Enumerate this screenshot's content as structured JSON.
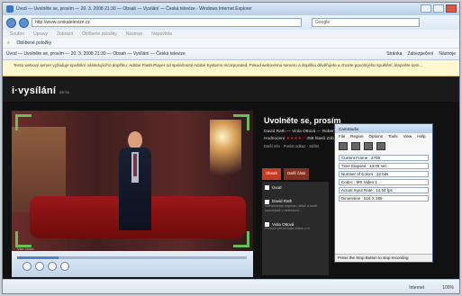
{
  "browser": {
    "title": "Úvod — Uvolněte se, prosím — 20. 3. 2008 21:30 — Obsah — Vysílání — Česká televize - Windows Internet Explorer",
    "url": "http://www.ceskatelevize.cz",
    "search_placeholder": "Google",
    "menu": [
      "Soubor",
      "Úpravy",
      "Zobrazit",
      "Oblíbené položky",
      "Nástroje",
      "Nápověda"
    ],
    "favorites_label": "Oblíbené položky",
    "tab_title": "Úvod — Uvolněte se, prosím — 20. 3. 2008 21:30 — Obsah — Vysílání — Česká televize",
    "commands": [
      "Stránka",
      "Zabezpečení",
      "Nástroje"
    ],
    "info_message": "Tento webový server vyžaduje spuštění následujícího doplňku: Adobe Flash Player od společnosti Adobe Systems Incorporated. Pokud webovému serveru a doplňku důvěřujete a chcete povolit jeho spuštění, klepněte sem...",
    "status_internet": "Internet",
    "zoom": "100%"
  },
  "site": {
    "brand": "i·vysílání",
    "beta": "BETA",
    "title": "Uvolněte se, prosím",
    "cast": "David Rath — Viola Ottová — Robert Fox",
    "rating_label": "Hodnocení",
    "stars": "★★★★☆",
    "votes": "359 hlasů",
    "views": "Zobrazeno: 220706×",
    "link_info": "Další info",
    "link_author": "Poslat odkaz",
    "link_share": "Sdílet",
    "tabs": [
      "Obsah",
      "Další části"
    ],
    "episodes": [
      {
        "name": "Úvod",
        "description": ""
      },
      {
        "name": "David Rath",
        "description": "Středočeský hejtman, lékař a nové souvislosti v detektivní..."
      },
      {
        "name": "Viola Ottová",
        "description": "Prvních pět let byla dívka u ní"
      }
    ]
  },
  "camstudio": {
    "title": "CamStudio",
    "menu": [
      "File",
      "Region",
      "Options",
      "Tools",
      "View",
      "Help"
    ],
    "fields": [
      "Current Frame : 2708",
      "Time Elapsed : 13:05 sec",
      "Number of Colors : 32 bits",
      "Codec : MS Video 1",
      "Actual Input Rate : 14.54 fps",
      "Dimension : 516 X 289"
    ],
    "status": "Press the Stop Button to stop recording"
  },
  "player": {
    "caption": "Vše: Úvod",
    "progress": 0.18
  }
}
